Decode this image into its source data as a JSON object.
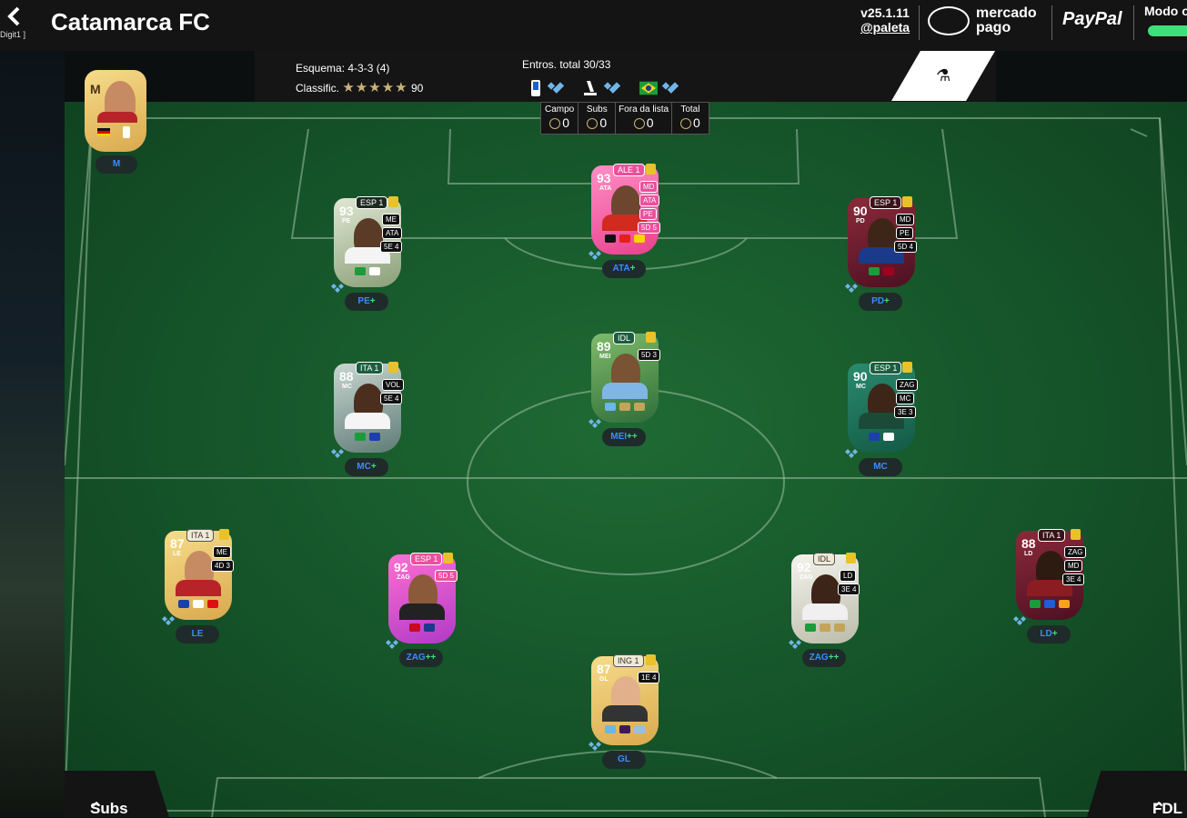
{
  "header": {
    "back_sub": "Digit1 ]",
    "club_name": "Catamarca FC",
    "version": "v25.1.11",
    "handle": "@paleta",
    "mercado_line1": "mercado",
    "mercado_line2": "pago",
    "paypal": "PayPal",
    "modo_label": "Modo o"
  },
  "info": {
    "formation_label": "Esquema: 4-3-3 (4)",
    "rating_label": "Classific.",
    "rating_stars": "★★★★★",
    "rating_value": "90",
    "chem_label": "Entros. total 30/33"
  },
  "counts": [
    {
      "label": "Campo",
      "value": "0"
    },
    {
      "label": "Subs",
      "value": "0"
    },
    {
      "label": "Fora da lista",
      "value": "0"
    },
    {
      "label": "Total",
      "value": "0"
    }
  ],
  "manager": {
    "rating": "M",
    "position": "M"
  },
  "players": [
    {
      "rating": "93",
      "pos": "PE",
      "slot": "PE",
      "plus": "+",
      "league": "ESP 1",
      "alts": [
        "ME",
        "ATA"
      ],
      "chem": "5E 4"
    },
    {
      "rating": "93",
      "pos": "ATA",
      "slot": "ATA",
      "plus": "+",
      "league": "ALE 1",
      "alts": [
        "MD",
        "ATA",
        "PE"
      ],
      "chem": "5D 5"
    },
    {
      "rating": "90",
      "pos": "PD",
      "slot": "PD",
      "plus": "+",
      "league": "ESP 1",
      "alts": [
        "MD",
        "PE"
      ],
      "chem": "5D 4"
    },
    {
      "rating": "88",
      "pos": "MC",
      "slot": "MC",
      "plus": "+",
      "league": "ITA 1",
      "alts": [
        "VOL"
      ],
      "chem": "5E 4"
    },
    {
      "rating": "89",
      "pos": "MEI",
      "slot": "MEI",
      "plus": "++",
      "league": "IDL",
      "alts": [],
      "chem": "5D 3"
    },
    {
      "rating": "90",
      "pos": "MC",
      "slot": "MC",
      "plus": "",
      "league": "ESP 1",
      "alts": [
        "ZAG",
        "MC"
      ],
      "chem": "3E 3"
    },
    {
      "rating": "87",
      "pos": "LE",
      "slot": "LE",
      "plus": "",
      "league": "ITA 1",
      "alts": [
        "ME"
      ],
      "chem": "4D 3"
    },
    {
      "rating": "92",
      "pos": "ZAG",
      "slot": "ZAG",
      "plus": "++",
      "league": "ESP 1",
      "alts": [],
      "chem": "5D 5"
    },
    {
      "rating": "92",
      "pos": "ZAG",
      "slot": "ZAG",
      "plus": "++",
      "league": "IDL",
      "alts": [
        "LD"
      ],
      "chem": "3E 4"
    },
    {
      "rating": "88",
      "pos": "LD",
      "slot": "LD",
      "plus": "+",
      "league": "ITA 1",
      "alts": [
        "ZAG",
        "MD"
      ],
      "chem": "3E 4"
    },
    {
      "rating": "87",
      "pos": "GL",
      "slot": "GL",
      "plus": "",
      "league": "ING 1",
      "alts": [],
      "chem": "1E 4"
    }
  ],
  "footer": {
    "subs_label": "Subs",
    "fdl_label": "FDL"
  },
  "colors": {
    "pitch": "#155429",
    "accent_green": "#3ee07a",
    "pos_blue": "#3a8cff",
    "gold": "#c9b37a"
  },
  "icons": {
    "back": "chevron-left-icon",
    "flask": "flask-icon",
    "chevron_up": "chevron-up-icon"
  }
}
